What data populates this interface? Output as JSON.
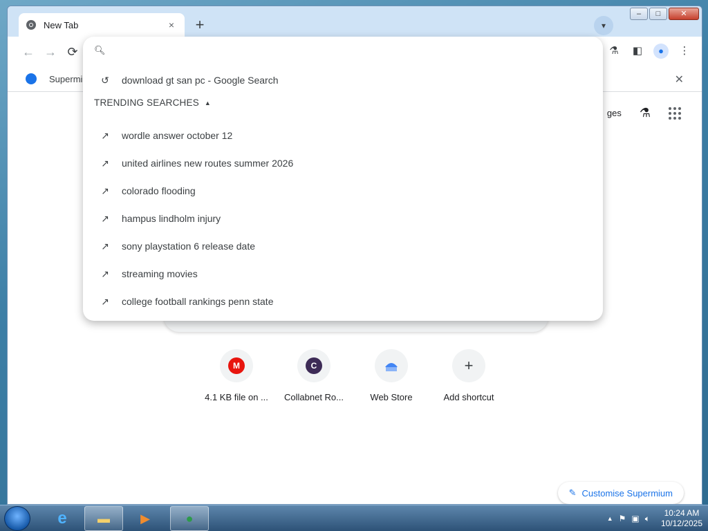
{
  "tab": {
    "title": "New Tab",
    "close": "×"
  },
  "toolbar": {
    "new_tab": "+",
    "back": "←",
    "forward": "→",
    "reload": "⟳"
  },
  "bookmark_bar": {
    "partial_label": "Supermi"
  },
  "omnibox": {
    "placeholder": "",
    "history_item": "download gt san pc - Google Search",
    "trending_header": "TRENDING SEARCHES",
    "trending": [
      "wordle answer october 12",
      "united airlines new routes summer 2026",
      "colorado flooding",
      "hampus lindholm injury",
      "sony playstation 6 release date",
      "streaming movies",
      "college football rankings penn state"
    ]
  },
  "ntp": {
    "images_partial": "ges",
    "shortcuts": [
      {
        "label": "4.1 KB file on ...",
        "letter": "M",
        "color": "#e8150e"
      },
      {
        "label": "Collabnet Ro...",
        "letter": "C",
        "color": "#3d2b56"
      },
      {
        "label": "Web Store",
        "letter": "",
        "color": "#4285f4"
      },
      {
        "label": "Add shortcut",
        "letter": "+",
        "color": "#3c4043"
      }
    ],
    "customise": "Customise Supermium"
  },
  "taskbar": {
    "time": "10:24 AM",
    "date": "10/12/2025"
  }
}
